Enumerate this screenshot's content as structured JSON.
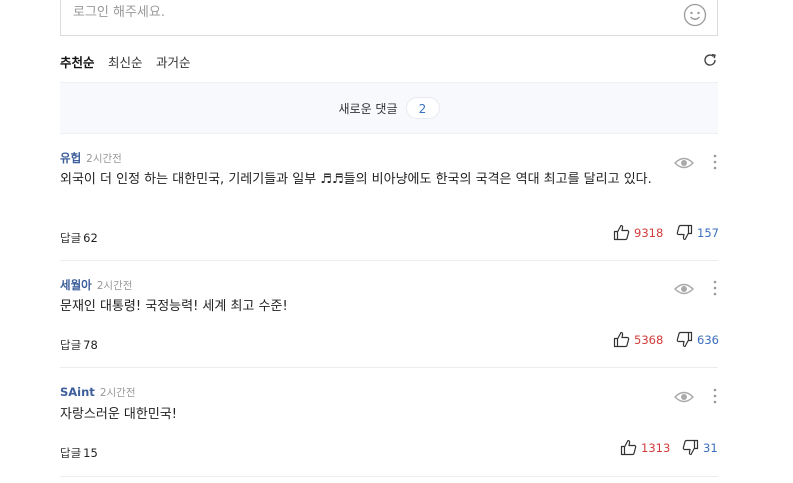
{
  "comment_input": {
    "placeholder": "로그인 해주세요.",
    "emoji_icon": "smiley-icon"
  },
  "sort": {
    "options": [
      "추천순",
      "최신순",
      "과거순"
    ],
    "active": "추천순",
    "refresh_icon": "refresh-icon"
  },
  "new_comments": {
    "label": "새로운 댓글",
    "count": "2"
  },
  "comments": [
    {
      "author": "유헙",
      "time": "2시간전",
      "text": "외국이 더 인정 하는 대한민국, 기레기들과 일부 ♬♬들의 비아냥에도 한국의 국격은 역대 최고를 달리고 있다.",
      "reply_label": "답글",
      "reply_count": "62",
      "likes": "9318",
      "dislikes": "157"
    },
    {
      "author": "세월아",
      "time": "2시간전",
      "text": "문재인 대통령! 국정능력! 세계 최고 수준!",
      "reply_label": "답글",
      "reply_count": "78",
      "likes": "5368",
      "dislikes": "636"
    },
    {
      "author": "SAint",
      "time": "2시간전",
      "text": "자랑스러운 대한민국!",
      "reply_label": "답글",
      "reply_count": "15",
      "likes": "1313",
      "dislikes": "31"
    }
  ],
  "colors": {
    "like": "#d23b3b",
    "dislike": "#3b6fbd",
    "author": "#3d5f9c"
  }
}
